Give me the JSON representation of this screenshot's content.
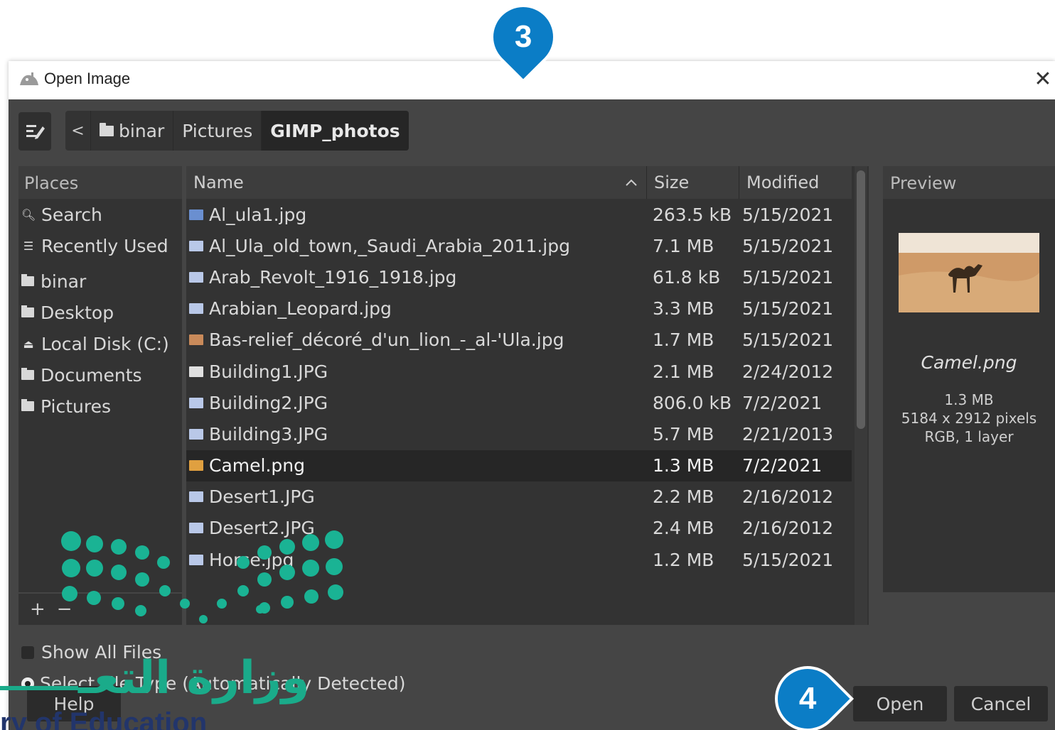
{
  "window": {
    "title": "Open Image",
    "close_icon": "close-icon"
  },
  "toolbar": {
    "edit_icon": "edit-location-icon",
    "back_glyph": "<",
    "breadcrumbs": [
      "binar",
      "Pictures",
      "GIMP_photos"
    ]
  },
  "places": {
    "header": "Places",
    "items": [
      {
        "label": "Search",
        "icon": "search-icon"
      },
      {
        "label": "Recently Used",
        "icon": "recent-icon"
      },
      {
        "label": "binar",
        "icon": "folder-icon"
      },
      {
        "label": "Desktop",
        "icon": "folder-icon"
      },
      {
        "label": "Local Disk (C:)",
        "icon": "drive-icon"
      },
      {
        "label": "Documents",
        "icon": "folder-icon"
      },
      {
        "label": "Pictures",
        "icon": "folder-icon"
      }
    ],
    "add_glyph": "+",
    "remove_glyph": "−"
  },
  "files": {
    "columns": {
      "name": "Name",
      "size": "Size",
      "modified": "Modified"
    },
    "rows": [
      {
        "name": "Al_ula1.jpg",
        "size": "263.5 kB",
        "modified": "5/15/2021",
        "color": "#6a8fd0"
      },
      {
        "name": "Al_Ula_old_town,_Saudi_Arabia_2011.jpg",
        "size": "7.1 MB",
        "modified": "5/15/2021",
        "color": "#b9c8e8"
      },
      {
        "name": "Arab_Revolt_1916_1918.jpg",
        "size": "61.8 kB",
        "modified": "5/15/2021",
        "color": "#b9c8e8"
      },
      {
        "name": "Arabian_Leopard.jpg",
        "size": "3.3 MB",
        "modified": "5/15/2021",
        "color": "#b9c8e8"
      },
      {
        "name": "Bas-relief_décoré_d'un_lion_-_al-'Ula.jpg",
        "size": "1.7 MB",
        "modified": "5/15/2021",
        "color": "#c98a5a"
      },
      {
        "name": "Building1.JPG",
        "size": "2.1 MB",
        "modified": "2/24/2012",
        "color": "#e0e0e0"
      },
      {
        "name": "Building2.JPG",
        "size": "806.0 kB",
        "modified": "7/2/2021",
        "color": "#b9c8e8"
      },
      {
        "name": "Building3.JPG",
        "size": "5.7 MB",
        "modified": "2/21/2013",
        "color": "#b9c8e8"
      },
      {
        "name": "Camel.png",
        "size": "1.3 MB",
        "modified": "7/2/2021",
        "color": "#e0a040",
        "selected": true
      },
      {
        "name": "Desert1.JPG",
        "size": "2.2 MB",
        "modified": "2/16/2012",
        "color": "#b9c8e8"
      },
      {
        "name": "Desert2.JPG",
        "size": "2.4 MB",
        "modified": "2/16/2012",
        "color": "#b9c8e8"
      },
      {
        "name": "Horse.jpg",
        "size": "1.2 MB",
        "modified": "5/15/2021",
        "color": "#b9c8e8"
      }
    ]
  },
  "preview": {
    "header": "Preview",
    "file_name": "Camel.png",
    "size": "1.3 MB",
    "dimensions": "5184 x 2912 pixels",
    "mode": "RGB, 1 layer"
  },
  "options": {
    "show_all_files": "Show All Files",
    "select_file_type": "Select File Type (Automatically Detected)"
  },
  "buttons": {
    "help": "Help",
    "open": "Open",
    "cancel": "Cancel"
  },
  "annotations": {
    "step3": "3",
    "step4": "4"
  },
  "watermark": {
    "arabic": "وزارة التعـ",
    "english": "ry of Education"
  }
}
